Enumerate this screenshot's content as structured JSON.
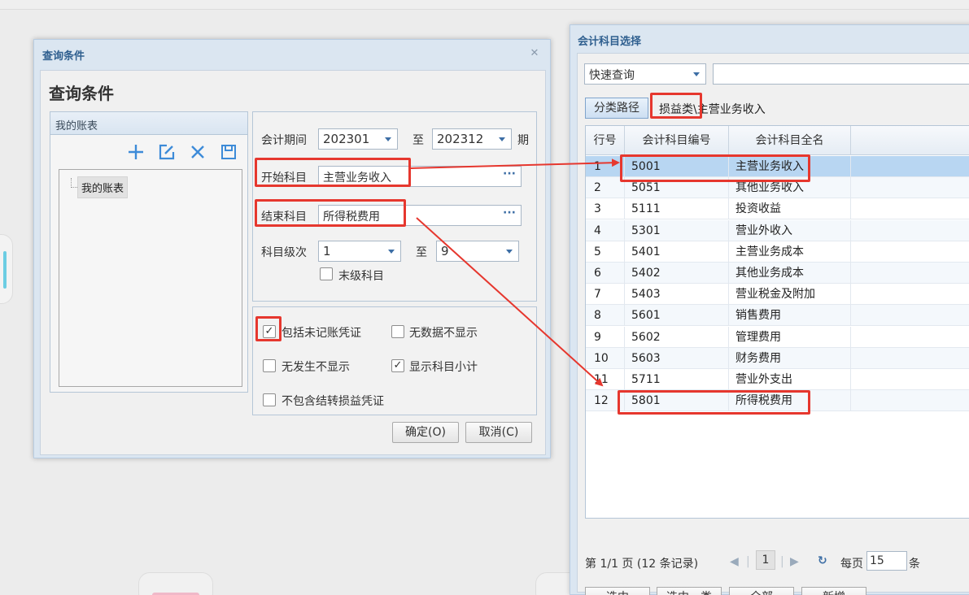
{
  "query_dialog": {
    "window_title": "查询条件",
    "heading": "查询条件",
    "accounts_panel": {
      "title": "我的账表",
      "tree_root": "我的账表",
      "tools": [
        "add-icon",
        "edit-icon",
        "delete-icon",
        "save-icon"
      ]
    },
    "period": {
      "label": "会计期间",
      "from": "202301",
      "to_label": "至",
      "to": "202312",
      "suffix": "期"
    },
    "start_subject": {
      "label": "开始科目",
      "value": "主营业务收入",
      "picker": "···"
    },
    "end_subject": {
      "label": "结束科目",
      "value": "所得税费用",
      "picker": "···"
    },
    "level": {
      "label": "科目级次",
      "from": "1",
      "to_label": "至",
      "to": "9"
    },
    "leaf_only": {
      "label": "末级科目",
      "checked": false
    },
    "options": [
      {
        "label": "包括未记账凭证",
        "checked": true
      },
      {
        "label": "无数据不显示",
        "checked": false
      },
      {
        "label": "无发生不显示",
        "checked": false
      },
      {
        "label": "显示科目小计",
        "checked": true
      },
      {
        "label": "不包含结转损益凭证",
        "checked": false
      }
    ],
    "ok_label": "确定(O)",
    "cancel_label": "取消(C)"
  },
  "picker": {
    "window_title": "会计科目选择",
    "quick_query_label": "快速查询",
    "search_value": "",
    "path_button": "分类路径",
    "path_category": "损益类",
    "path_rest": "\\主营业务收入",
    "columns": [
      "行号",
      "会计科目编号",
      "会计科目全名"
    ],
    "rows": [
      {
        "no": "1",
        "code": "5001",
        "name": "主营业务收入"
      },
      {
        "no": "2",
        "code": "5051",
        "name": "其他业务收入"
      },
      {
        "no": "3",
        "code": "5111",
        "name": "投资收益"
      },
      {
        "no": "4",
        "code": "5301",
        "name": "营业外收入"
      },
      {
        "no": "5",
        "code": "5401",
        "name": "主营业务成本"
      },
      {
        "no": "6",
        "code": "5402",
        "name": "其他业务成本"
      },
      {
        "no": "7",
        "code": "5403",
        "name": "营业税金及附加"
      },
      {
        "no": "8",
        "code": "5601",
        "name": "销售费用"
      },
      {
        "no": "9",
        "code": "5602",
        "name": "管理费用"
      },
      {
        "no": "10",
        "code": "5603",
        "name": "财务费用"
      },
      {
        "no": "11",
        "code": "5711",
        "name": "营业外支出"
      },
      {
        "no": "12",
        "code": "5801",
        "name": "所得税费用"
      }
    ],
    "selected_row": "1",
    "pager": {
      "info": "第 1/1 页 (12 条记录)",
      "current_page": "1",
      "per_page_label": "每页",
      "per_page": "15",
      "per_page_unit": "条"
    },
    "buttons": {
      "select": "选中",
      "select_class": "选中一类",
      "all": "全部",
      "add": "新增"
    }
  },
  "colors": {
    "highlight": "#e6372e",
    "accent": "#3d8bd8",
    "selected_row": "#b8d6f2"
  }
}
